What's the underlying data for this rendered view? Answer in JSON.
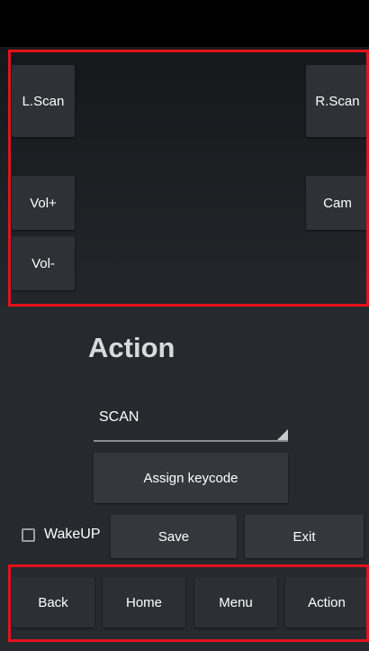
{
  "hardware_keys": {
    "left_scan": "L.Scan",
    "right_scan": "R.Scan",
    "volume_up": "Vol+",
    "camera": "Cam",
    "volume_down": "Vol-"
  },
  "action_panel": {
    "title": "Action",
    "keycode_select": {
      "selected": "SCAN"
    },
    "assign_label": "Assign keycode",
    "wakeup_label": "WakeUP",
    "wakeup_checked": false,
    "save_label": "Save",
    "exit_label": "Exit"
  },
  "nav_bar": {
    "back": "Back",
    "home": "Home",
    "menu": "Menu",
    "action": "Action"
  },
  "colors": {
    "highlight": "#e3121b",
    "background": "#262a2f"
  }
}
